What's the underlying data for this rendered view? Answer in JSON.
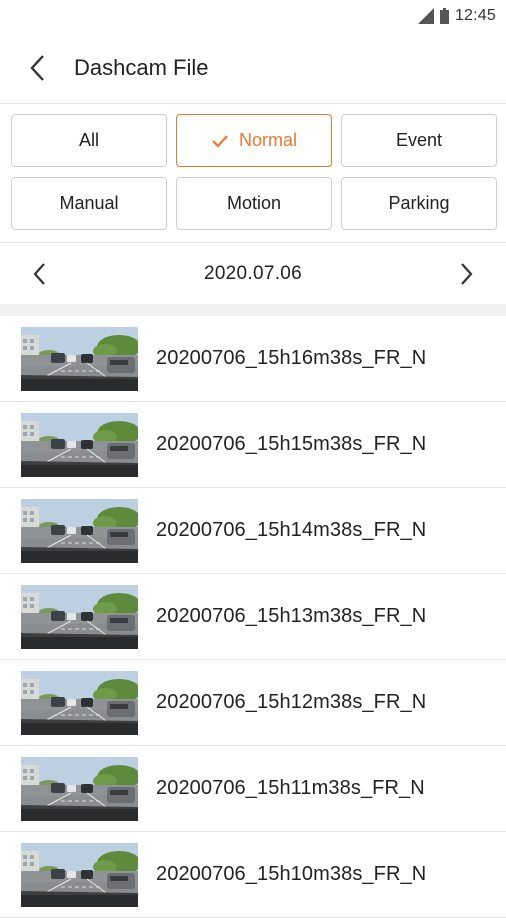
{
  "status_bar": {
    "time": "12:45",
    "icons": [
      "signal-icon",
      "battery-icon"
    ]
  },
  "app_bar": {
    "title": "Dashcam File",
    "back_icon": "chevron-left-icon"
  },
  "filters": [
    {
      "label": "All",
      "selected": false
    },
    {
      "label": "Normal",
      "selected": true
    },
    {
      "label": "Event",
      "selected": false
    },
    {
      "label": "Manual",
      "selected": false
    },
    {
      "label": "Motion",
      "selected": false
    },
    {
      "label": "Parking",
      "selected": false
    }
  ],
  "colors": {
    "accent": "#e8782e",
    "border": "#cfcfcf",
    "divider": "#e4e4e4"
  },
  "date_nav": {
    "date": "2020.07.06",
    "prev_icon": "chevron-left-icon",
    "next_icon": "chevron-right-icon"
  },
  "files": [
    {
      "name": "20200706_15h16m38s_FR_N"
    },
    {
      "name": "20200706_15h15m38s_FR_N"
    },
    {
      "name": "20200706_15h14m38s_FR_N"
    },
    {
      "name": "20200706_15h13m38s_FR_N"
    },
    {
      "name": "20200706_15h12m38s_FR_N"
    },
    {
      "name": "20200706_15h11m38s_FR_N"
    },
    {
      "name": "20200706_15h10m38s_FR_N"
    }
  ]
}
